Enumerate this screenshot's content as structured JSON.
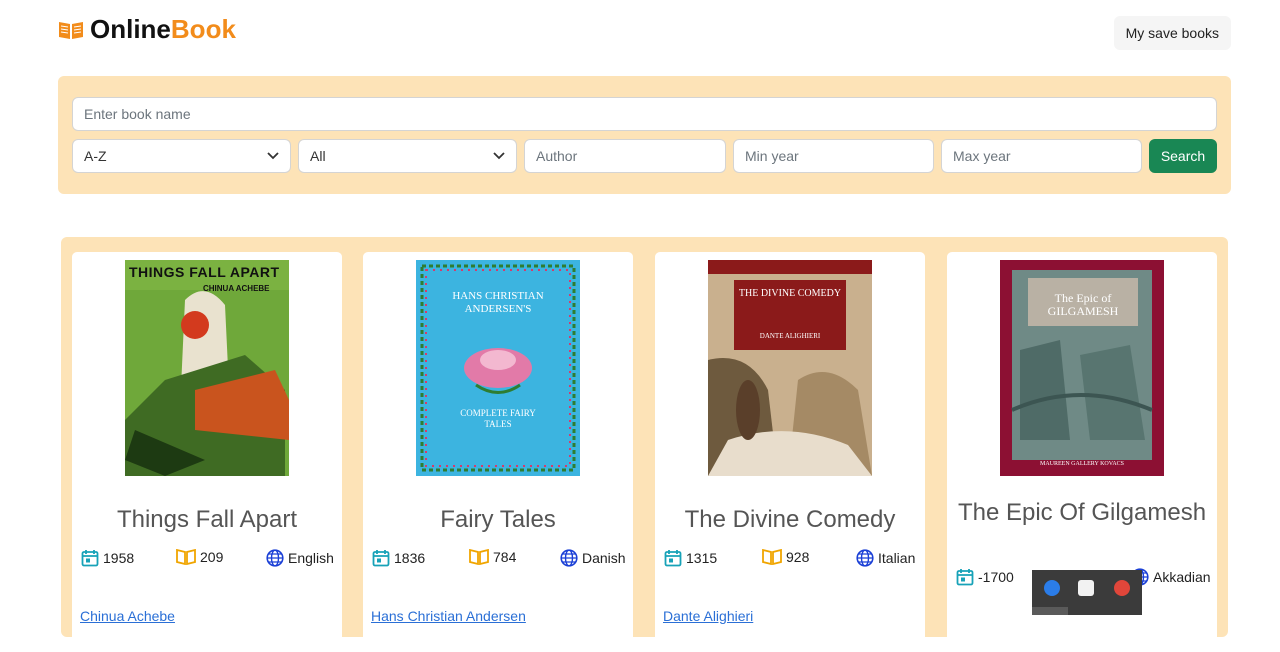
{
  "brand": {
    "part1": "Online",
    "part2": "Book",
    "icon": "open-book-icon"
  },
  "nav": {
    "saved_label": "My save books"
  },
  "search": {
    "name_placeholder": "Enter book name",
    "sort_value": "A-Z",
    "category_value": "All",
    "author_placeholder": "Author",
    "min_year_placeholder": "Min year",
    "max_year_placeholder": "Max year",
    "button_label": "Search"
  },
  "books": [
    {
      "title": "Things Fall Apart",
      "year": "1958",
      "pages": "209",
      "language": "English",
      "author": "Chinua Achebe",
      "cover_text": "THINGS FALL APART",
      "cover_sub": "CHINUA ACHEBE"
    },
    {
      "title": "Fairy Tales",
      "year": "1836",
      "pages": "784",
      "language": "Danish",
      "author": "Hans Christian Andersen",
      "cover_text": "HANS CHRISTIAN ANDERSEN'S",
      "cover_sub": "COMPLETE FAIRY TALES"
    },
    {
      "title": "The Divine Comedy",
      "year": "1315",
      "pages": "928",
      "language": "Italian",
      "author": "Dante Alighieri",
      "cover_text": "THE DIVINE COMEDY",
      "cover_sub": "DANTE ALIGHIERI"
    },
    {
      "title": "The Epic Of Gilgamesh",
      "year": "-1700",
      "pages": "",
      "language": "Akkadian",
      "author": "",
      "cover_text": "The Epic of GILGAMESH",
      "cover_sub": "MAUREEN GALLERY KOVACS"
    }
  ],
  "colors": {
    "accent": "#f28c1b",
    "panel": "#fde3b7",
    "search_button": "#198754",
    "link": "#2a6fd6"
  }
}
